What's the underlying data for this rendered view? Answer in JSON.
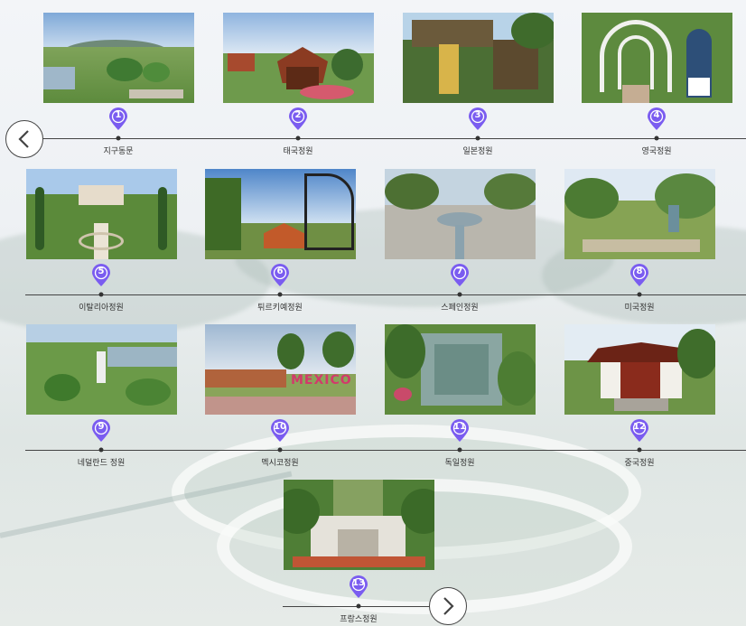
{
  "colors": {
    "pin": "#7a5cf0",
    "line": "#444444"
  },
  "nav": {
    "prev_icon": "chevron-left-icon",
    "next_icon": "chevron-right-icon"
  },
  "gardens": [
    {
      "num": "1",
      "label": "지구동문"
    },
    {
      "num": "2",
      "label": "태국정원"
    },
    {
      "num": "3",
      "label": "일본정원"
    },
    {
      "num": "4",
      "label": "영국정원"
    },
    {
      "num": "5",
      "label": "이탈리아정원"
    },
    {
      "num": "6",
      "label": "튀르키예정원"
    },
    {
      "num": "7",
      "label": "스페인정원"
    },
    {
      "num": "8",
      "label": "미국정원"
    },
    {
      "num": "9",
      "label": "네덜란드 정원"
    },
    {
      "num": "10",
      "label": "멕시코정원"
    },
    {
      "num": "11",
      "label": "독일정원"
    },
    {
      "num": "12",
      "label": "중국정원"
    },
    {
      "num": "13",
      "label": "프랑스정원"
    }
  ],
  "photo_texts": {
    "mexico_sign": "MEXICO"
  }
}
